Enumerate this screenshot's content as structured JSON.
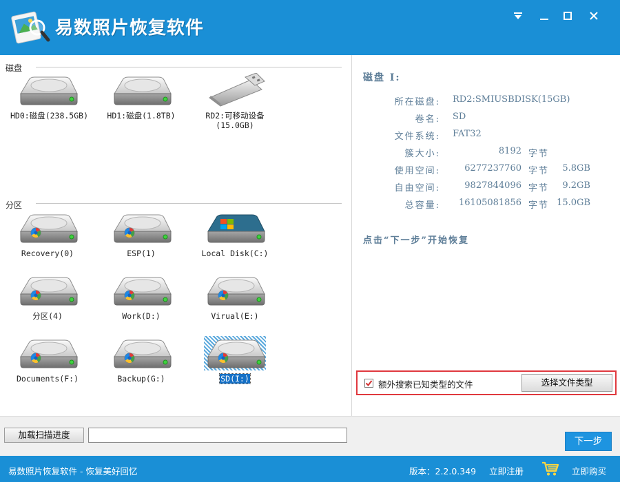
{
  "app": {
    "title": "易数照片恢复软件"
  },
  "window_controls": {
    "menu_icon": "menu-down-icon",
    "minimize_icon": "minimize-icon",
    "maximize_icon": "maximize-icon",
    "close_icon": "close-icon"
  },
  "left": {
    "disks_label": "磁盘",
    "partitions_label": "分区",
    "disks": [
      {
        "label": "HD0:磁盘(238.5GB)",
        "icon": "hard-disk-icon"
      },
      {
        "label": "HD1:磁盘(1.8TB)",
        "icon": "hard-disk-icon"
      },
      {
        "label_line1": "RD2:可移动设备",
        "label_line2": "(15.0GB)",
        "icon": "usb-drive-icon"
      }
    ],
    "partitions": [
      {
        "label": "Recovery(0)",
        "icon": "partition-icon"
      },
      {
        "label": "ESP(1)",
        "icon": "partition-icon"
      },
      {
        "label": "Local Disk(C:)",
        "icon": "windows-partition-icon"
      },
      {
        "label": "分区(4)",
        "icon": "partition-icon"
      },
      {
        "label": "Work(D:)",
        "icon": "partition-icon"
      },
      {
        "label": "Virual(E:)",
        "icon": "partition-icon"
      },
      {
        "label": "Documents(F:)",
        "icon": "partition-icon"
      },
      {
        "label": "Backup(G:)",
        "icon": "partition-icon"
      },
      {
        "label": "SD(I:)",
        "icon": "partition-icon",
        "selected": true
      }
    ]
  },
  "info": {
    "title": "磁盘 I:",
    "rows": {
      "owner": {
        "key": "所在磁盘:",
        "value": "RD2:SMIUSBDISK(15GB)"
      },
      "volume": {
        "key": "卷名:",
        "value": "SD"
      },
      "fs": {
        "key": "文件系统:",
        "value": "FAT32"
      },
      "cluster": {
        "key": "簇大小:",
        "value": "8192",
        "unit": "字节"
      },
      "used": {
        "key": "使用空间:",
        "value": "6277237760",
        "unit": "字节",
        "human": "5.8GB"
      },
      "free": {
        "key": "自由空间:",
        "value": "9827844096",
        "unit": "字节",
        "human": "9.2GB"
      },
      "total": {
        "key": "总容量:",
        "value": "16105081856",
        "unit": "字节",
        "human": "15.0GB"
      }
    },
    "hint": "点击“下一步”开始恢复"
  },
  "options": {
    "search_known_types_label": "额外搜索已知类型的文件",
    "search_known_types_checked": true,
    "select_types_button": "选择文件类型"
  },
  "bottom": {
    "load_progress_button": "加载扫描进度",
    "progress_value": "",
    "next_button": "下一步"
  },
  "status": {
    "slogan": "易数照片恢复软件 - 恢复美好回忆",
    "version": "版本：2.2.0.349",
    "register": "立即注册",
    "buy": "立即购买"
  },
  "colors": {
    "brand_blue": "#1a8fd6",
    "info_text": "#5e7e98",
    "highlight_red": "#e0383e",
    "selection_blue": "#1570c6"
  }
}
